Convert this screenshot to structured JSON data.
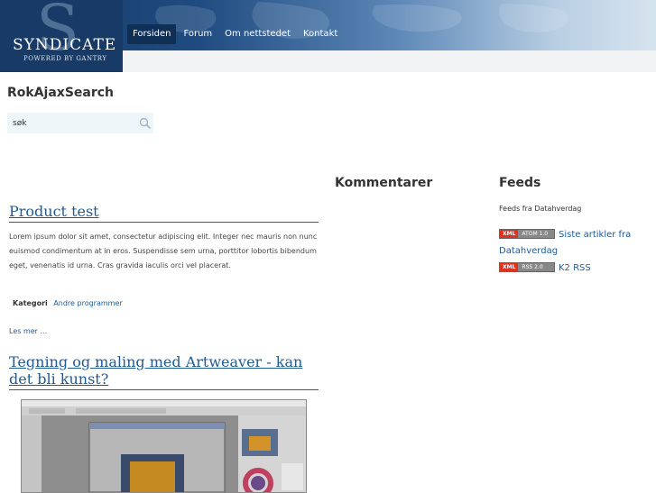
{
  "logo": {
    "big_letter": "S",
    "name": "SYNDICATE",
    "tagline": "POWERED BY GANTRY"
  },
  "nav": {
    "items": [
      "Forsiden",
      "Forum",
      "Om nettstedet",
      "Kontakt"
    ],
    "active": "Forsiden"
  },
  "search": {
    "title": "RokAjaxSearch",
    "value": "søk"
  },
  "sections": {
    "comments": "Kommentarer",
    "feeds": "Feeds"
  },
  "articles": [
    {
      "title": "Product test",
      "body": "Lorem ipsum dolor sit amet, consectetur adipiscing elit. Integer nec mauris non nunc euismod condimentum at in eros. Suspendisse sem urna, porttitor lobortis bibendum eget, venenatis id urna. Cras gravida iaculis orci vel placerat.",
      "category_label": "Kategori",
      "category": "Andre programmer",
      "read_more": "Les mer ..."
    },
    {
      "title": "Tegning og maling med Artweaver - kan det bli kunst?"
    }
  ],
  "feeds": {
    "subtitle": "Feeds fra Datahverdag",
    "items": [
      {
        "badge_left": "XML",
        "badge_right": "ATOM 1.0",
        "label": "Siste artikler fra Datahverdag"
      },
      {
        "badge_left": "XML",
        "badge_right": "RSS 2.0",
        "label": "K2 RSS"
      }
    ]
  },
  "colors": {
    "header_dark": "#173a66",
    "nav_active": "#0f2f55",
    "link": "#1e5a96",
    "search_bg": "#eef6fa"
  }
}
